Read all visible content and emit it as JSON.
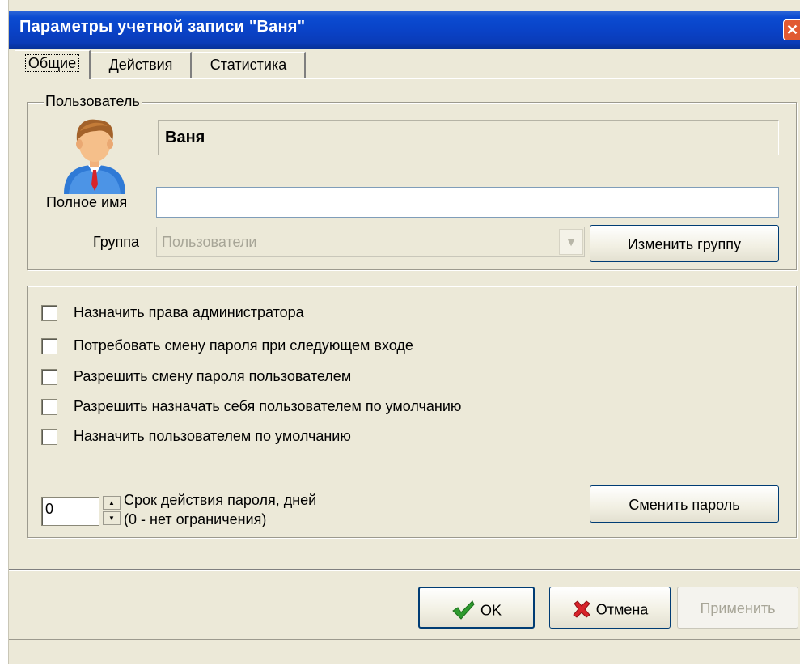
{
  "window": {
    "title": "Параметры учетной записи \"Ваня\"",
    "close_label": "✕"
  },
  "tabs": [
    {
      "label": "Общие",
      "active": true
    },
    {
      "label": "Действия",
      "active": false
    },
    {
      "label": "Статистика",
      "active": false
    }
  ],
  "user": {
    "legend": "Пользователь",
    "username": "Ваня",
    "fullname_label": "Полное имя",
    "fullname_value": "",
    "group_label": "Группа",
    "group_value": "Пользователи",
    "change_group_label": "Изменить группу"
  },
  "options": [
    {
      "label": "Назначить права администратора",
      "checked": false
    },
    {
      "label": "Потребовать смену пароля при следующем входе",
      "checked": false
    },
    {
      "label": "Разрешить смену пароля пользователем",
      "checked": false
    },
    {
      "label": "Разрешить назначать себя пользователем по умолчанию",
      "checked": false
    },
    {
      "label": "Назначить пользователем по умолчанию",
      "checked": false
    }
  ],
  "password": {
    "expiry_value": "0",
    "expiry_label_line1": "Срок действия пароля, дней",
    "expiry_label_line2": "(0 - нет ограничения)",
    "change_password_label": "Сменить пароль"
  },
  "footer": {
    "ok_label": "OK",
    "cancel_label": "Отмена",
    "apply_label": "Применить"
  },
  "colors": {
    "titlebar": "#0a42c6",
    "face": "#ece9d8",
    "button_border": "#003c74",
    "disabled_text": "#a7a597"
  }
}
